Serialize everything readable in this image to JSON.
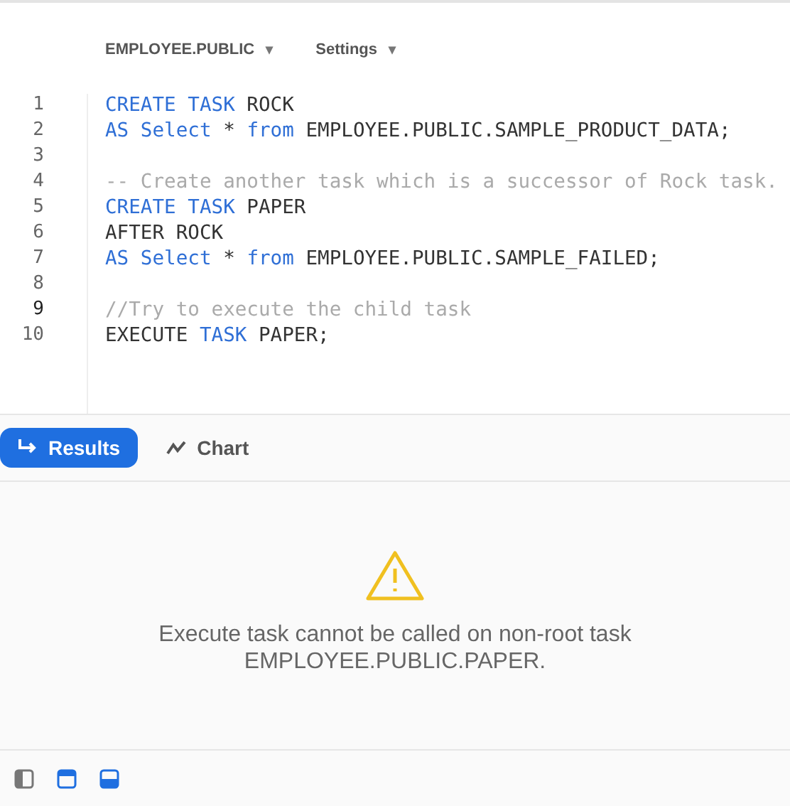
{
  "toolbar": [
    {
      "label": "EMPLOYEE.PUBLIC",
      "caret": "▾"
    },
    {
      "label": "Settings",
      "caret": "▾"
    }
  ],
  "editor": {
    "lines": [
      {
        "number": "1",
        "current": false,
        "tokens": [
          {
            "kind": "keyword",
            "text": "CREATE TASK"
          },
          {
            "kind": "plain",
            "text": " ROCK"
          }
        ]
      },
      {
        "number": "2",
        "current": false,
        "tokens": [
          {
            "kind": "keyword",
            "text": "AS Select"
          },
          {
            "kind": "plain",
            "text": " * "
          },
          {
            "kind": "keyword",
            "text": "from"
          },
          {
            "kind": "plain",
            "text": " EMPLOYEE.PUBLIC.SAMPLE_PRODUCT_DATA;"
          }
        ]
      },
      {
        "number": "3",
        "current": false
      },
      {
        "number": "4",
        "current": false,
        "tokens": [
          {
            "kind": "comment",
            "text": "-- Create another task which is a successor of Rock task."
          }
        ]
      },
      {
        "number": "5",
        "current": false,
        "tokens": [
          {
            "kind": "keyword",
            "text": "CREATE TASK"
          },
          {
            "kind": "plain",
            "text": " PAPER"
          }
        ]
      },
      {
        "number": "6",
        "current": false,
        "tokens": [
          {
            "kind": "plain",
            "text": "AFTER ROCK"
          }
        ]
      },
      {
        "number": "7",
        "current": false,
        "tokens": [
          {
            "kind": "keyword",
            "text": "AS Select"
          },
          {
            "kind": "plain",
            "text": " * "
          },
          {
            "kind": "keyword",
            "text": "from"
          },
          {
            "kind": "plain",
            "text": " EMPLOYEE.PUBLIC.SAMPLE_FAILED;"
          }
        ]
      },
      {
        "number": "8",
        "current": false
      },
      {
        "number": "9",
        "current": true,
        "tokens": [
          {
            "kind": "comment",
            "text": "//Try to execute the child task"
          }
        ]
      },
      {
        "number": "10",
        "current": false,
        "tokens": [
          {
            "kind": "plain",
            "text": "EXECUTE "
          },
          {
            "kind": "keyword",
            "text": "TASK"
          },
          {
            "kind": "plain",
            "text": " PAPER;"
          }
        ]
      }
    ]
  },
  "result_tabs": [
    {
      "label": "Results",
      "kind": "results",
      "selected": true
    },
    {
      "label": "Chart",
      "kind": "chart",
      "selected": false
    }
  ],
  "message": {
    "lines": [
      "Execute task cannot be called on non-root task",
      "EMPLOYEE.PUBLIC.PAPER."
    ]
  },
  "footer_toggles": [
    {
      "kind": "sidebar",
      "selected": false
    },
    {
      "kind": "top",
      "selected": true
    },
    {
      "kind": "bottom",
      "selected": true
    }
  ]
}
